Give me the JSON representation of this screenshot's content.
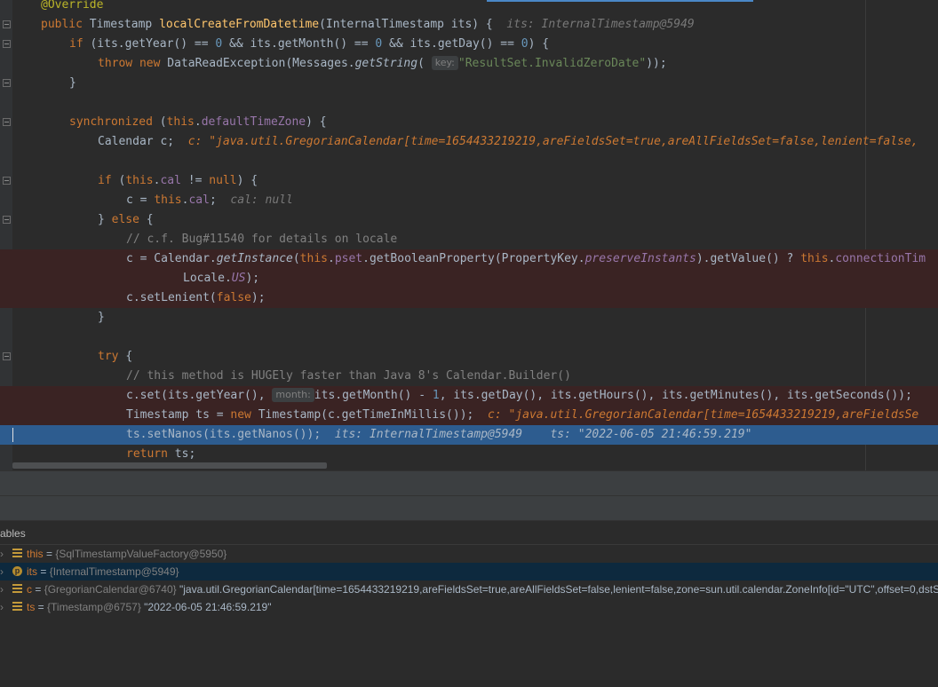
{
  "editor": {
    "lines": [
      {
        "type": "annotation",
        "text": "@Override"
      },
      {
        "type": "sig",
        "kw": "public ",
        "ret": "Timestamp ",
        "fn": "localCreateFromDatetime",
        "params": "(InternalTimestamp its) {",
        "hint": "its: InternalTimestamp@5949"
      },
      {
        "type": "if1"
      },
      {
        "type": "throw",
        "string": "\"ResultSet.InvalidZeroDate\"",
        "chip": "key:"
      },
      {
        "type": "close1"
      },
      {
        "type": "blank"
      },
      {
        "type": "sync"
      },
      {
        "type": "calendar",
        "hint": "c: \"java.util.GregorianCalendar[time=1654433219219,areFieldsSet=true,areAllFieldsSet=false,lenient=false,"
      },
      {
        "type": "blank"
      },
      {
        "type": "ifcal"
      },
      {
        "type": "assigncal",
        "hint": "cal: null"
      },
      {
        "type": "else"
      },
      {
        "type": "comment",
        "text": "// c.f. Bug#11540 for details on locale"
      },
      {
        "type": "getinst"
      },
      {
        "type": "locale"
      },
      {
        "type": "lenient"
      },
      {
        "type": "close2"
      },
      {
        "type": "blank"
      },
      {
        "type": "try"
      },
      {
        "type": "comment2",
        "text": "// this method is HUGEly faster than Java 8's Calendar.Builder()"
      },
      {
        "type": "cset",
        "chip": "month:"
      },
      {
        "type": "tsnew",
        "hint": "c: \"java.util.GregorianCalendar[time=1654433219219,areFieldsSe"
      },
      {
        "type": "nanos",
        "hint1": "its: InternalTimestamp@5949",
        "hint2": "ts: \"2022-06-05 21:46:59.219\""
      },
      {
        "type": "ret"
      }
    ]
  },
  "panel": {
    "title": "ables"
  },
  "variables": [
    {
      "icon": "field",
      "name": "this",
      "type": "{SqlTimestampValueFactory@5950}",
      "value": ""
    },
    {
      "icon": "param",
      "name": "its",
      "type": "{InternalTimestamp@5949}",
      "value": ""
    },
    {
      "icon": "field",
      "name": "c",
      "type": "{GregorianCalendar@6740}",
      "value": "\"java.util.GregorianCalendar[time=1654433219219,areFieldsSet=true,areAllFieldsSet=false,lenient=false,zone=sun.util.calendar.ZoneInfo[id=\"UTC\",offset=0,dstS"
    },
    {
      "icon": "field",
      "name": "ts",
      "type": "{Timestamp@6757}",
      "value": "\"2022-06-05 21:46:59.219\""
    }
  ]
}
